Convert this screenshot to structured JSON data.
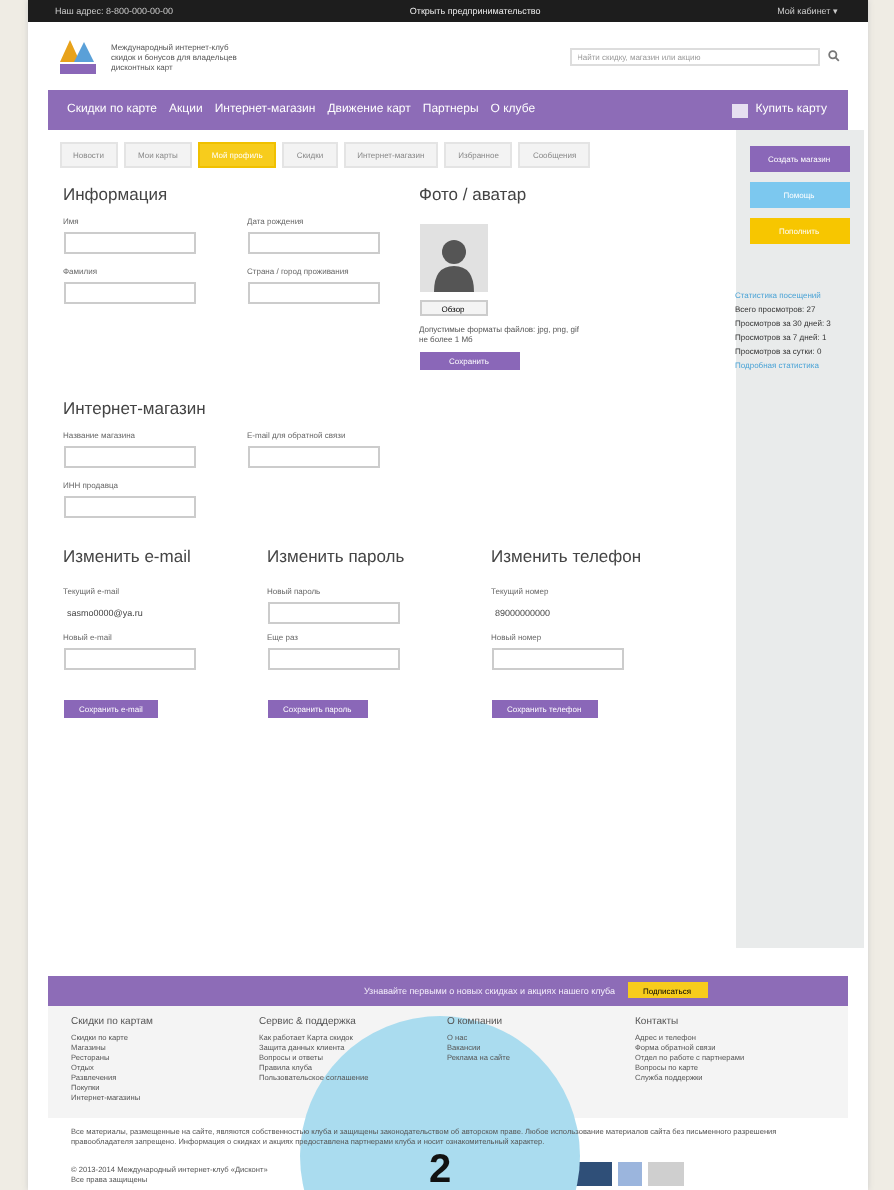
{
  "top_bar": {
    "phone": "Наш адрес: 8-800-000-00-00",
    "center": "Открыть предпринимательство",
    "account": "Мой кабинет ▾"
  },
  "header": {
    "tagline": "Международный интернет-клуб скидок и бонусов для владельцев дисконтных карт",
    "search": {
      "placeholder": "Найти скидку, магазин или акцию"
    }
  },
  "nav": {
    "items": [
      "Скидки по карте",
      "Акции",
      "Интернет-магазин",
      "Движение карт",
      "Партнеры",
      "О клубе"
    ],
    "cta": "Купить карту"
  },
  "tabs": [
    {
      "label": "Новости",
      "selected": false
    },
    {
      "label": "Мои карты",
      "selected": false
    },
    {
      "label": "Мой профиль",
      "selected": true
    },
    {
      "label": "Скидки",
      "selected": false
    },
    {
      "label": "Интернет-магазин",
      "selected": false
    },
    {
      "label": "Избранное",
      "selected": false
    },
    {
      "label": "Сообщения",
      "selected": false
    }
  ],
  "info": {
    "title": "Информация",
    "fields": [
      {
        "label": "Имя"
      },
      {
        "label": "Дата рождения"
      },
      {
        "label": "Фамилия"
      },
      {
        "label": "Страна / город проживания"
      }
    ]
  },
  "photo": {
    "title": "Фото / аватар",
    "browse": "Обзор",
    "hint": "Допустимые форматы файлов: jpg, png, gif не более 1 Мб",
    "save": "Сохранить"
  },
  "shop": {
    "title": "Интернет-магазин",
    "fields": [
      {
        "label": "Название магазина"
      },
      {
        "label": "E-mail для обратной связи"
      },
      {
        "label": "ИНН продавца"
      }
    ]
  },
  "change_blocks": [
    {
      "title": "Изменить e-mail",
      "fields": [
        {
          "label": "Текущий e-mail",
          "value": "sasmo0000@ya.ru",
          "kind": "static"
        },
        {
          "label": "Новый e-mail",
          "kind": "input"
        }
      ],
      "button": "Сохранить e-mail"
    },
    {
      "title": "Изменить пароль",
      "fields": [
        {
          "label": "Новый пароль",
          "kind": "input"
        },
        {
          "label": "Еще раз",
          "kind": "input"
        }
      ],
      "button": "Сохранить пароль"
    },
    {
      "title": "Изменить телефон",
      "fields": [
        {
          "label": "Текущий номер",
          "value": "89000000000",
          "kind": "static"
        },
        {
          "label": "Новый номер",
          "kind": "input"
        }
      ],
      "button": "Сохранить телефон"
    }
  ],
  "sidebar": {
    "buttons": [
      {
        "label": "Создать магазин",
        "color": "#8a67b8"
      },
      {
        "label": "Помощь",
        "color": "#7cc8ef"
      },
      {
        "label": "Пополнить",
        "color": "#f7c600"
      }
    ],
    "stats_title": "Статистика посещений",
    "stats": [
      "Всего просмотров: 27",
      "Просмотров за 30 дней: 3",
      "Просмотров за 7 дней: 1",
      "Просмотров за сутки: 0"
    ],
    "stats_link": "Подробная статистика"
  },
  "footer": {
    "band_text": "Узнавайте первыми о новых скидках и акциях нашего клуба",
    "subscribe": "Подписаться",
    "columns": [
      {
        "title": "Скидки по картам",
        "items": [
          "Скидки по карте",
          "Магазины",
          "Рестораны",
          "Отдых",
          "Развлечения",
          "Покупки",
          "Интернет-магазины"
        ]
      },
      {
        "title": "Сервис & поддержка",
        "items": [
          "Как работает Карта скидок",
          "Защита данных клиента",
          "Вопросы и ответы",
          "Правила клуба",
          "Пользовательское соглашение"
        ]
      },
      {
        "title": "О компании",
        "items": [
          "О нас",
          "Вакансии",
          "Реклама на сайте"
        ]
      },
      {
        "title": "Контакты",
        "items": [
          "Адрес и телефон",
          "Форма обратной связи",
          "Отдел по работе с партнерами",
          "Вопросы по карте",
          "Служба поддержки"
        ]
      }
    ],
    "legal": "Все материалы, размещенные на сайте, являются собственностью клуба и защищены законодательством об авторском праве. Любое использование материалов сайта без письменного разрешения правообладателя запрещено. Информация о скидках и акциях предоставлена партнерами клуба и носит ознакомительный характер.",
    "copyright": "© 2013-2014 Международный интернет-клуб «Дисконт»",
    "rights": "Все права защищены"
  },
  "marker": {
    "number": "2"
  }
}
